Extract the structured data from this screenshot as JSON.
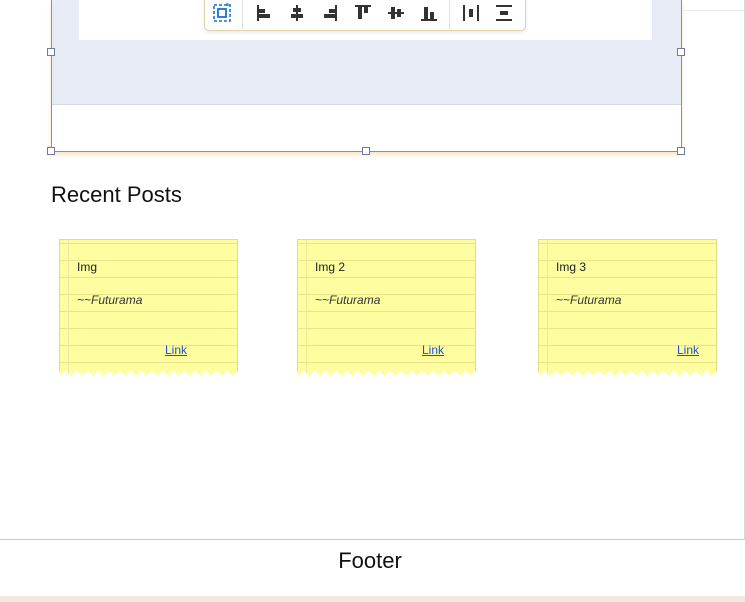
{
  "toolbar": {
    "buttons": [
      {
        "icon": "group-select-icon",
        "color": "#1a6fd6"
      },
      {
        "icon": "align-left-icon"
      },
      {
        "icon": "align-center-horizontal-icon"
      },
      {
        "icon": "align-right-icon"
      },
      {
        "icon": "align-top-icon"
      },
      {
        "icon": "align-middle-vertical-icon"
      },
      {
        "icon": "align-bottom-icon"
      },
      {
        "icon": "distribute-horizontal-icon"
      },
      {
        "icon": "distribute-vertical-icon"
      }
    ]
  },
  "section": {
    "title": "Recent Posts"
  },
  "posts": [
    {
      "title": "Img",
      "author": "~~Futurama",
      "link": "Link"
    },
    {
      "title": "Img 2",
      "author": "~~Futurama",
      "link": "Link"
    },
    {
      "title": "Img 3",
      "author": "~~Futurama",
      "link": "Link"
    }
  ],
  "footer": {
    "label": "Footer"
  },
  "colors": {
    "note_background": "#fefea0",
    "link": "#1a55c8",
    "panel": "#e6ebf5"
  }
}
